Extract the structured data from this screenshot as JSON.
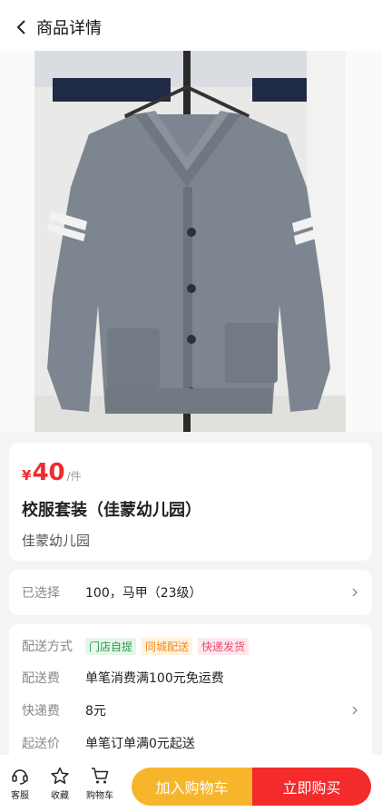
{
  "header": {
    "title": "商品详情"
  },
  "gallery": {
    "image_count": 1,
    "active_index": 0
  },
  "product": {
    "currency": "¥",
    "price": "40",
    "unit": "/件",
    "title": "校服套装（佳蒙幼儿园）",
    "store": "佳蒙幼儿园"
  },
  "selection": {
    "label": "已选择",
    "value": "100，马甲（23级）"
  },
  "delivery": {
    "method_label": "配送方式",
    "tags": [
      "门店自提",
      "同城配送",
      "快递发货"
    ],
    "fee_label": "配送费",
    "fee_value": "单笔消费满100元免运费",
    "express_label": "快递费",
    "express_value": "8元",
    "min_label": "起送价",
    "min_value": "单笔订单满0元起送"
  },
  "bottom_bar": {
    "service_label": "客服",
    "favorite_label": "收藏",
    "cart_label": "购物车",
    "add_cart_label": "加入购物车",
    "buy_now_label": "立即购买"
  },
  "colors": {
    "accent_red": "#f42b2b",
    "accent_yellow": "#f7b52b",
    "tag_green": "#2e9a4a",
    "tag_orange": "#f08c1a",
    "tag_red": "#ea4a6b"
  }
}
